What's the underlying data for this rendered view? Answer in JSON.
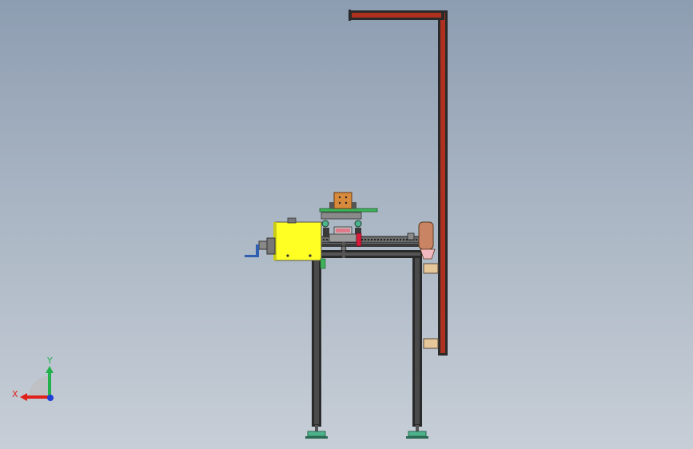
{
  "viewport": {
    "background_top": "#8d9db1",
    "background_bottom": "#c7ced7"
  },
  "triad": {
    "y_label": "Y",
    "x_label": "X",
    "y_color": "#22b14c",
    "x_color": "#e0201b",
    "z_color": "#1f3fd6"
  },
  "model": {
    "frame_color": "#2a2a2a",
    "frame_accent": "#b0301f",
    "gearbox_color": "#ffff24",
    "plate_color": "#3fb35a",
    "block_color": "#d88a3c",
    "pad_color": "#e6c79a",
    "stop_color": "#c88463",
    "handle_color": "#2f5fae",
    "foot_color": "#4db38c"
  }
}
